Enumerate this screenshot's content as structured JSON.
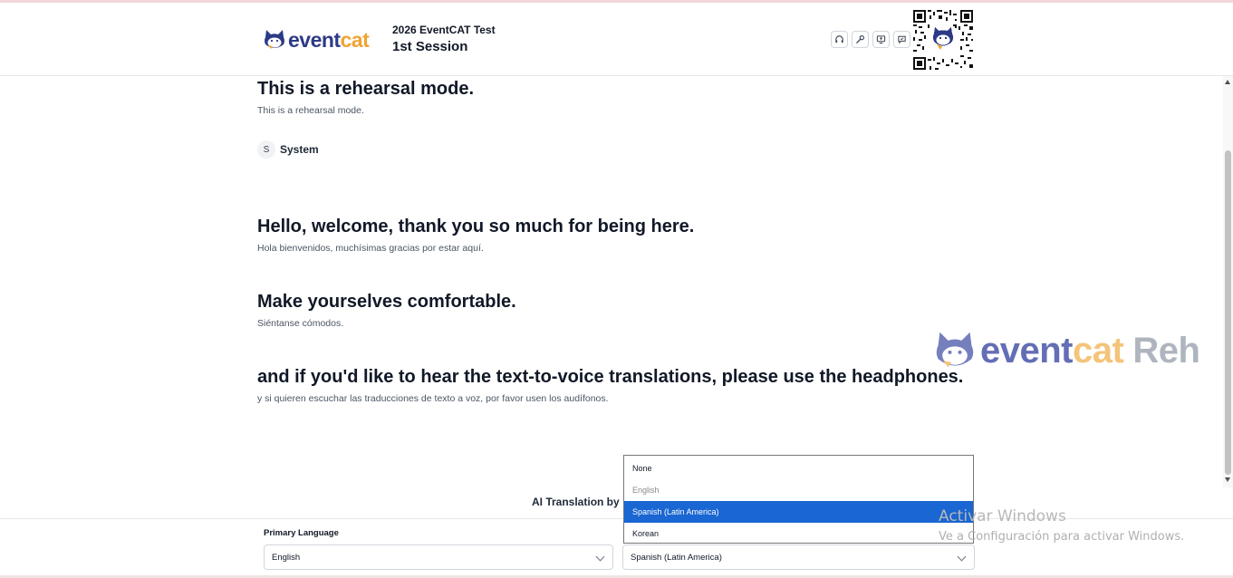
{
  "header": {
    "logo_event": "event",
    "logo_cat": "cat",
    "session_title": "2026 EventCAT Test",
    "session_name": "1st Session",
    "buttons": [
      {
        "icon": "headphones-icon"
      },
      {
        "icon": "wrench-icon"
      },
      {
        "icon": "screen-share-icon"
      },
      {
        "icon": "chat-icon"
      }
    ]
  },
  "messages": [
    {
      "text": "This is a rehearsal mode.",
      "translation": "This is a rehearsal mode."
    },
    {
      "text": "Hello, welcome, thank you so much for being here.",
      "translation": "Hola bienvenidos, muchísimas gracias por estar aquí."
    },
    {
      "text": "Make yourselves comfortable.",
      "translation": "Siéntanse cómodos."
    },
    {
      "text": "and if you'd like to hear the text-to-voice translations, please use the headphones.",
      "translation": "y si quieren escuchar las traducciones de texto a voz, por favor usen los audífonos."
    }
  ],
  "speaker": {
    "initial": "S",
    "name": "System"
  },
  "watermark": {
    "event": "event",
    "cat": "cat",
    "suffix": "Reh"
  },
  "ai_translation": "AI Translation by",
  "footer": {
    "primary_label": "Primary Language",
    "primary_value": "English",
    "secondary_value": "Spanish (Latin America)"
  },
  "dropdown": {
    "options": [
      "None",
      "English",
      "Spanish (Latin America)",
      "Korean"
    ],
    "selected": "Spanish (Latin America)",
    "disabled": "English"
  },
  "windows": {
    "title": "Activar Windows",
    "subtitle": "Ve a Configuración para activar Windows."
  },
  "colors": {
    "brand_navy": "#2d3a86",
    "brand_orange": "#f0a432",
    "select_highlight": "#1a66d2"
  }
}
